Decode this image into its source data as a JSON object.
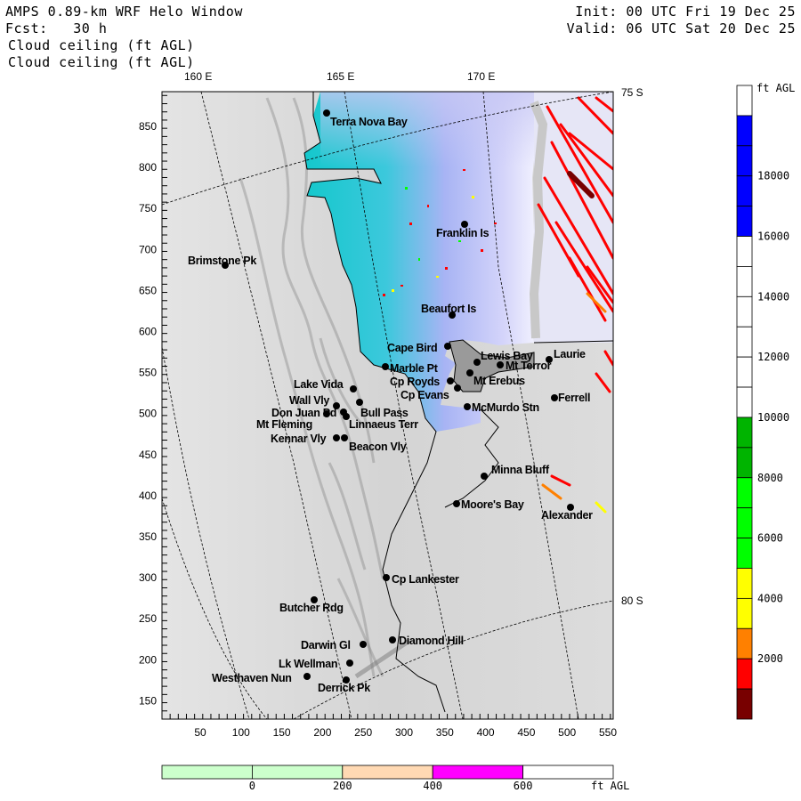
{
  "header": {
    "title": "AMPS 0.89-km WRF Helo Window",
    "forecast": "Fcst:   30 h",
    "init": "Init: 00 UTC Fri 19 Dec 25",
    "valid": "Valid: 06 UTC Sat 20 Dec 25",
    "field1": "Cloud ceiling (ft AGL)",
    "field2": "Cloud ceiling (ft AGL)"
  },
  "map": {
    "lon_labels": [
      "160 E",
      "165 E",
      "170 E"
    ],
    "lat_labels": [
      "75 S",
      "80 S"
    ],
    "x_ticks": [
      "50",
      "100",
      "150",
      "200",
      "250",
      "300",
      "350",
      "400",
      "450",
      "500",
      "550"
    ],
    "y_ticks": [
      "850",
      "800",
      "750",
      "700",
      "650",
      "600",
      "550",
      "500",
      "450",
      "400",
      "350",
      "300",
      "250",
      "200",
      "150"
    ],
    "stations": [
      "Terra Nova Bay",
      "Brimstone Pk",
      "Franklin Is",
      "Beaufort Is",
      "Cape Bird",
      "Lewis Bay",
      "Laurie",
      "Mt Terror",
      "Marble Pt",
      "Mt Erebus",
      "Cp Royds",
      "Cp Evans",
      "Ferrell",
      "Lake Vida",
      "Wall Vly",
      "Bull Pass",
      "Don Juan Pd",
      "McMurdo Stn",
      "Mt Fleming",
      "Linnaeus Terr",
      "Kennar Vly",
      "Beacon Vly",
      "Minna Bluff",
      "Moore's Bay",
      "Alexander",
      "Cp Lankester",
      "Butcher Rdg",
      "Diamond Hill",
      "Darwin Gl",
      "Lk Wellman",
      "Westhaven Nun",
      "Derrick Pk"
    ]
  },
  "colorbar_ceiling": {
    "unit": "ft AGL",
    "labels": [
      "18000",
      "16000",
      "14000",
      "12000",
      "10000",
      "8000",
      "6000",
      "4000",
      "2000"
    ],
    "colors_top_to_bottom": [
      "#ffffff",
      "#0000ff",
      "#0000ff",
      "#0000ff",
      "#0000ff",
      "#ffffff",
      "#ffffff",
      "#ffffff",
      "#ffffff",
      "#ffffff",
      "#ffffff",
      "#00b400",
      "#00b400",
      "#00ff00",
      "#00ff00",
      "#00ff00",
      "#ffff00",
      "#ffff00",
      "#ff8000",
      "#ff0000",
      "#780000"
    ]
  },
  "colorbar_terrain": {
    "unit": "ft AGL",
    "labels": [
      "0",
      "200",
      "400",
      "600"
    ],
    "colors": [
      "#ccffcc",
      "#ccffcc",
      "#ffd9b3",
      "#ff00ff",
      "#ffffff"
    ]
  }
}
